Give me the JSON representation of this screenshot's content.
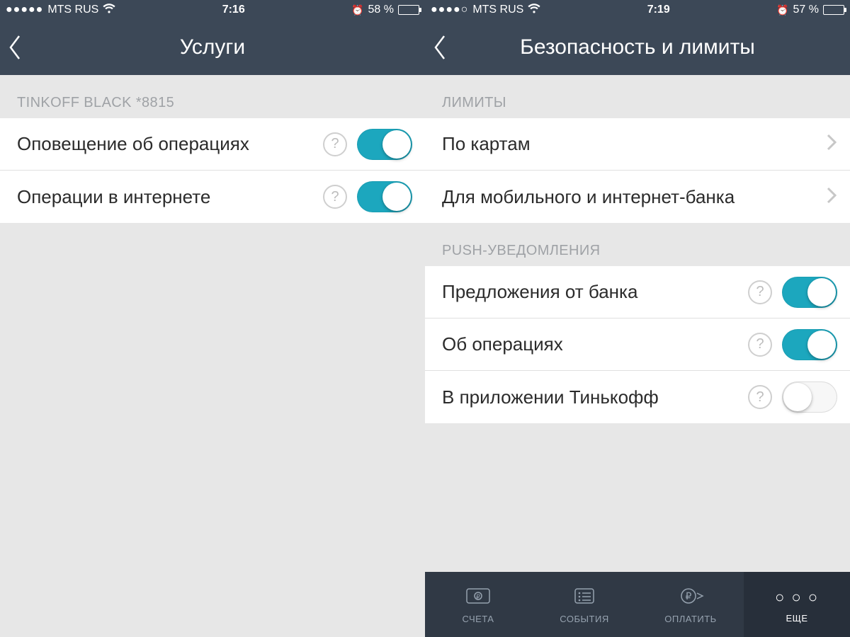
{
  "left": {
    "status": {
      "carrier": "MTS RUS",
      "signal": "●●●●●",
      "time": "7:16",
      "battery_text": "58 %",
      "battery_pct": 58
    },
    "nav_title": "Услуги",
    "section1_header": "TINKOFF BLACK *8815",
    "rows": [
      {
        "label": "Оповещение об операциях",
        "help": "?",
        "toggle": "on"
      },
      {
        "label": "Операции в интернете",
        "help": "?",
        "toggle": "on"
      }
    ]
  },
  "right": {
    "status": {
      "carrier": "MTS RUS",
      "signal": "●●●●○",
      "time": "7:19",
      "battery_text": "57 %",
      "battery_pct": 57
    },
    "nav_title": "Безопасность и лимиты",
    "limits_header": "ЛИМИТЫ",
    "limits_rows": [
      {
        "label": "По картам"
      },
      {
        "label": "Для мобильного и интернет-банка"
      }
    ],
    "push_header": "PUSH-УВЕДОМЛЕНИЯ",
    "push_rows": [
      {
        "label": "Предложения от банка",
        "help": "?",
        "toggle": "on"
      },
      {
        "label": "Об операциях",
        "help": "?",
        "toggle": "on"
      },
      {
        "label": "В приложении Тинькофф",
        "help": "?",
        "toggle": "off"
      }
    ],
    "tabs": [
      {
        "label": "СЧЕТА"
      },
      {
        "label": "СОБЫТИЯ"
      },
      {
        "label": "ОПЛАТИТЬ"
      },
      {
        "label": "ЕЩЕ",
        "active": true
      }
    ]
  }
}
